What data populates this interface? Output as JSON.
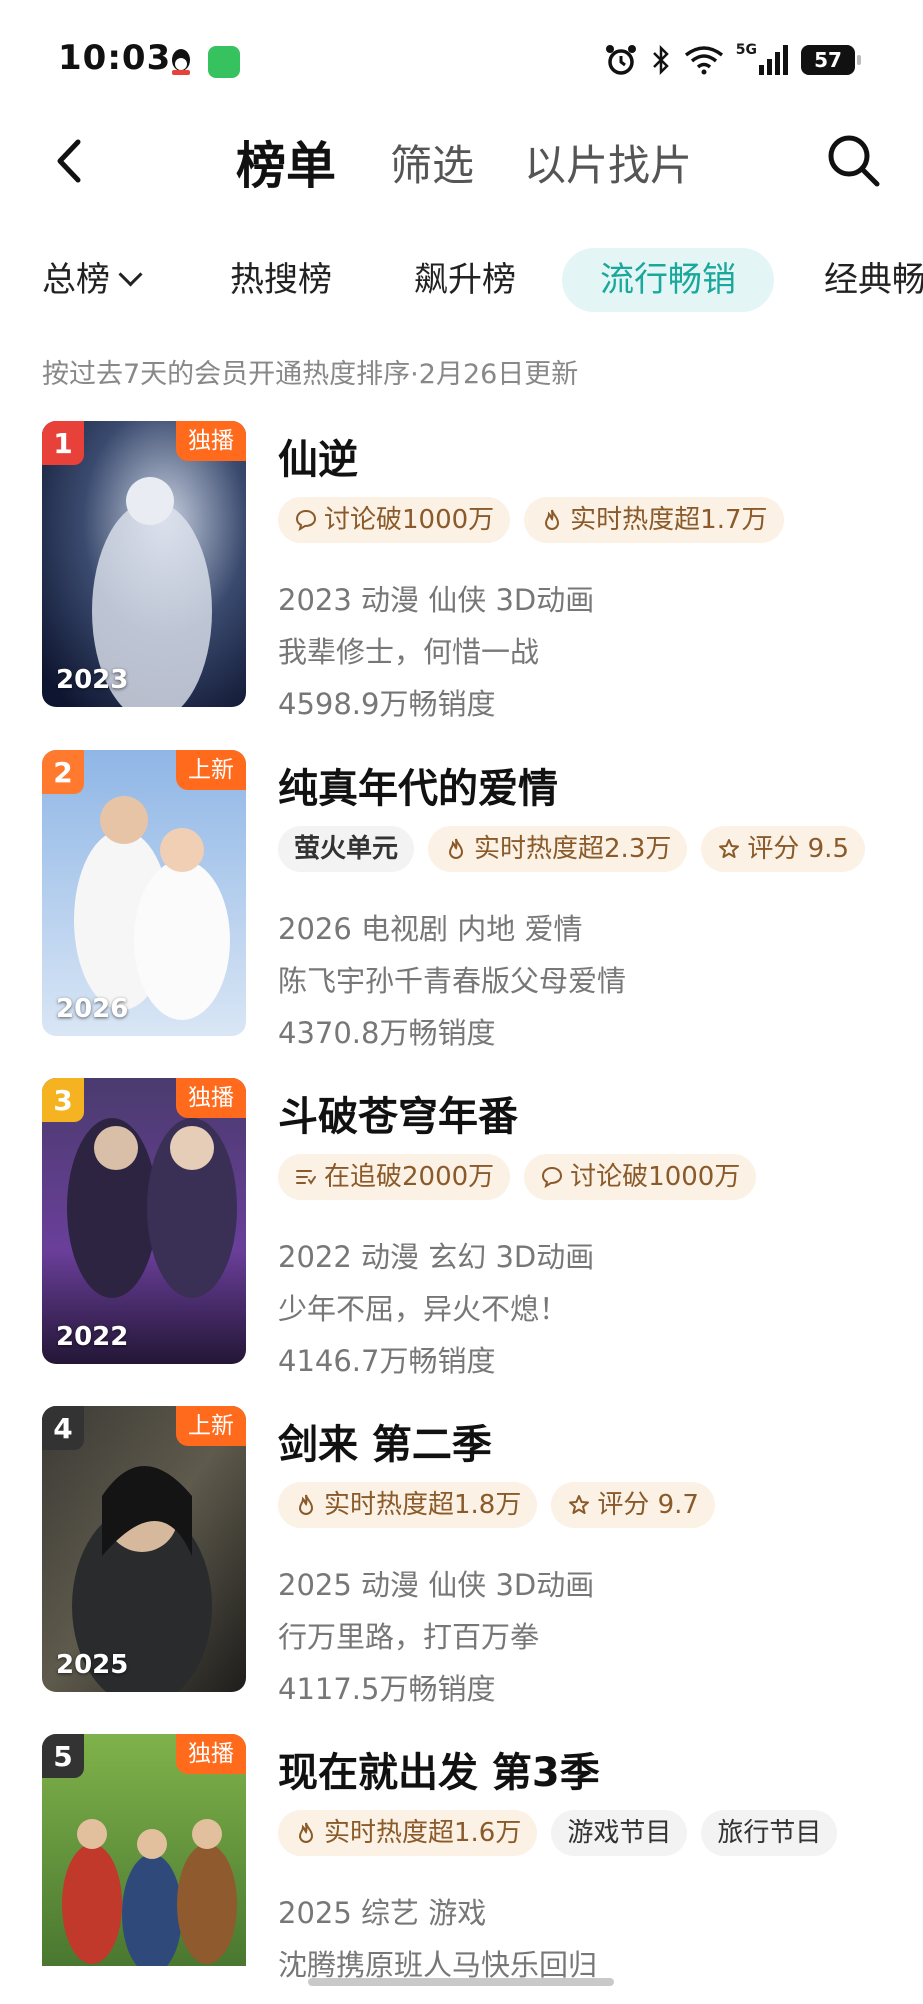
{
  "status_bar": {
    "time": "10:03",
    "network": "5G",
    "battery": "57"
  },
  "topnav": {
    "tabs": [
      "榜单",
      "筛选",
      "以片找片"
    ]
  },
  "categories": [
    "总榜",
    "热搜榜",
    "飙升榜",
    "流行畅销",
    "经典畅销"
  ],
  "subtitle": "按过去7天的会员开通热度排序·2月26日更新",
  "items": [
    {
      "rank": "1",
      "badge": "独播",
      "title": "仙逆",
      "year": "2023",
      "tags": [
        {
          "icon": "comment-icon",
          "text": "讨论破1000万",
          "style": "warm"
        },
        {
          "icon": "flame-icon",
          "text": "实时热度超1.7万",
          "style": "warm"
        }
      ],
      "meta": "2023 动漫 仙侠 3D动画",
      "desc": "我辈修士，何惜一战",
      "sales": "4598.9万畅销度"
    },
    {
      "rank": "2",
      "badge": "上新",
      "title": "纯真年代的爱情",
      "year": "2026",
      "tags": [
        {
          "icon": "",
          "text": "萤火单元",
          "style": "gray"
        },
        {
          "icon": "flame-icon",
          "text": "实时热度超2.3万",
          "style": "warm"
        },
        {
          "icon": "star-icon",
          "text": "评分 9.5",
          "style": "warm"
        }
      ],
      "meta": "2026 电视剧 内地 爱情",
      "desc": "陈飞宇孙千青春版父母爱情",
      "sales": "4370.8万畅销度"
    },
    {
      "rank": "3",
      "badge": "独播",
      "title": "斗破苍穹年番",
      "year": "2022",
      "tags": [
        {
          "icon": "list-icon",
          "text": "在追破2000万",
          "style": "warm"
        },
        {
          "icon": "comment-icon",
          "text": "讨论破1000万",
          "style": "warm"
        }
      ],
      "meta": "2022 动漫 玄幻 3D动画",
      "desc": "少年不屈，异火不熄！",
      "sales": "4146.7万畅销度"
    },
    {
      "rank": "4",
      "badge": "上新",
      "title": "剑来 第二季",
      "year": "2025",
      "tags": [
        {
          "icon": "flame-icon",
          "text": "实时热度超1.8万",
          "style": "warm"
        },
        {
          "icon": "star-icon",
          "text": "评分 9.7",
          "style": "warm"
        }
      ],
      "meta": "2025 动漫 仙侠 3D动画",
      "desc": "行万里路，打百万拳",
      "sales": "4117.5万畅销度"
    },
    {
      "rank": "5",
      "badge": "独播",
      "title": "现在就出发 第3季",
      "year": "",
      "tags": [
        {
          "icon": "flame-icon",
          "text": "实时热度超1.6万",
          "style": "warm"
        },
        {
          "icon": "",
          "text": "游戏节目",
          "style": "gray"
        },
        {
          "icon": "",
          "text": "旅行节目",
          "style": "gray"
        }
      ],
      "meta": "2025 综艺 游戏",
      "desc": "沈腾携原班人马快乐回归",
      "sales": ""
    }
  ],
  "colors": {
    "accent_teal": "#1aa79c",
    "badge_orange": "#ff6a1c",
    "rank1": "#e8413a",
    "rank2": "#ff7a2f",
    "rank3": "#f5b321",
    "rank_other": "#333333"
  }
}
